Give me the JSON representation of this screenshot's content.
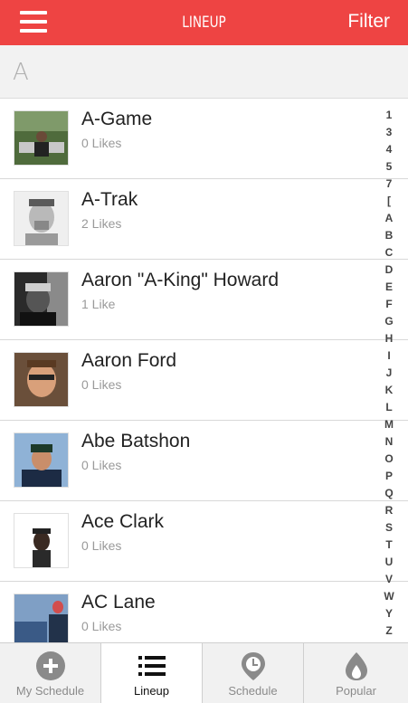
{
  "header": {
    "title": "LINEUP",
    "filter_label": "Filter",
    "menu_icon": "hamburger-icon",
    "bg_color": "#ee4443"
  },
  "section": {
    "letter": "A"
  },
  "artists": [
    {
      "name": "A-Game",
      "likes": "0 Likes"
    },
    {
      "name": "A-Trak",
      "likes": "2 Likes"
    },
    {
      "name": "Aaron \"A-King\" Howard",
      "likes": "1 Like"
    },
    {
      "name": "Aaron Ford",
      "likes": "0 Likes"
    },
    {
      "name": "Abe Batshon",
      "likes": "0 Likes"
    },
    {
      "name": "Ace Clark",
      "likes": "0 Likes"
    },
    {
      "name": "AC Lane",
      "likes": "0 Likes"
    }
  ],
  "index": [
    "1",
    "3",
    "4",
    "5",
    "7",
    "[",
    "A",
    "B",
    "C",
    "D",
    "E",
    "F",
    "G",
    "H",
    "I",
    "J",
    "K",
    "L",
    "M",
    "N",
    "O",
    "P",
    "Q",
    "R",
    "S",
    "T",
    "U",
    "V",
    "W",
    "Y",
    "Z"
  ],
  "tabs": [
    {
      "label": "My Schedule",
      "icon": "plus-circle-icon",
      "active": false
    },
    {
      "label": "Lineup",
      "icon": "list-icon",
      "active": true
    },
    {
      "label": "Schedule",
      "icon": "clock-pin-icon",
      "active": false
    },
    {
      "label": "Popular",
      "icon": "flame-icon",
      "active": false
    }
  ]
}
